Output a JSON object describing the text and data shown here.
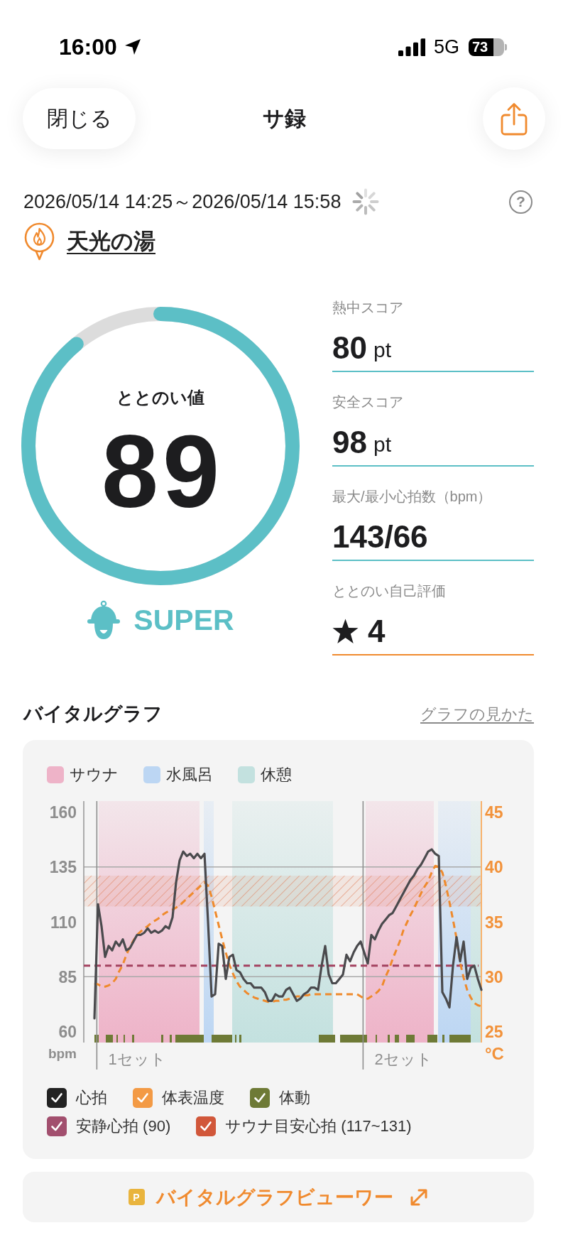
{
  "status_bar": {
    "time": "16:00",
    "network": "5G",
    "battery": "73"
  },
  "nav": {
    "close_button": "閉じる",
    "title": "サ録"
  },
  "session": {
    "period": "2026/05/14 14:25～2026/05/14 15:58",
    "loading": true,
    "help": "?",
    "facility": "天光の湯"
  },
  "gauge": {
    "label": "ととのい値",
    "value": "89",
    "level": 0.89,
    "rank": "SUPER"
  },
  "scores": [
    {
      "kind": "score",
      "label": "熱中スコア",
      "value": "80",
      "unit": "pt"
    },
    {
      "kind": "score",
      "label": "安全スコア",
      "value": "98",
      "unit": "pt"
    },
    {
      "kind": "score",
      "label": "最大/最小心拍数（bpm）",
      "value": "143/66"
    },
    {
      "kind": "rating",
      "label": "ととのい自己評価",
      "value": "4"
    }
  ],
  "vital_graph": {
    "title": "バイタルグラフ",
    "help_link": "グラフの見かた",
    "phase_legend": [
      {
        "label": "サウナ",
        "color": "#eeb3c8"
      },
      {
        "label": "水風呂",
        "color": "#bcd6f3"
      },
      {
        "label": "休憩",
        "color": "#c3e1df"
      }
    ],
    "chart_data": {
      "type": "line",
      "ylabel": "bpm",
      "y2label": "°C",
      "categories": [
        null,
        null,
        null,
        null,
        null,
        null,
        null,
        null,
        null,
        null,
        null,
        null,
        null,
        null,
        null,
        "1セット",
        null,
        null,
        null,
        null,
        null,
        null,
        null,
        null,
        null,
        null,
        null,
        null,
        null,
        null,
        null,
        null,
        null,
        null,
        null,
        null,
        null,
        null,
        null,
        null,
        null,
        null,
        null,
        null,
        null,
        null,
        null,
        null,
        null,
        null,
        null,
        null,
        null,
        null,
        null,
        null,
        null,
        null,
        null,
        null,
        null,
        null,
        null,
        null,
        null,
        null,
        null,
        null,
        null,
        null,
        null,
        null,
        null,
        null,
        null,
        null,
        null,
        null,
        null,
        null,
        null,
        null,
        null,
        null,
        null,
        null,
        null,
        null,
        null,
        null,
        "2セット",
        null,
        null,
        null,
        null,
        null,
        null,
        null,
        null,
        null,
        null,
        null,
        null,
        null,
        null,
        null,
        null,
        null,
        null,
        null,
        null,
        null,
        null
      ],
      "ylim": [
        55,
        165
      ],
      "yticks": [
        60,
        85,
        110,
        135,
        160
      ],
      "y2lim": [
        24,
        46
      ],
      "y2ticks": [
        25,
        30,
        35,
        40,
        45
      ],
      "series": [
        {
          "color": "#4a4a4d",
          "values": [
            null,
            null,
            null,
            66,
            118,
            108,
            94,
            99,
            97,
            101,
            99,
            102,
            97,
            98,
            101,
            104,
            104,
            105,
            107,
            105,
            106,
            105,
            106,
            108,
            107,
            112,
            128,
            138,
            142,
            140,
            141,
            139,
            141,
            139,
            141,
            110,
            76,
            77,
            100,
            99,
            84,
            94,
            95,
            88,
            87,
            84,
            82,
            82,
            80,
            80,
            80,
            78,
            74,
            74,
            77,
            76,
            76,
            79,
            80,
            77,
            74,
            75,
            77,
            78,
            80,
            80,
            79,
            90,
            99,
            86,
            82,
            82,
            84,
            86,
            95,
            92,
            96,
            99,
            101,
            96,
            91,
            104,
            102,
            106,
            109,
            111,
            113,
            114,
            117,
            120,
            123,
            126,
            129,
            131,
            134,
            136,
            139,
            142,
            143,
            141,
            140,
            78,
            75,
            71,
            90,
            103,
            92,
            101,
            84,
            89,
            90,
            84,
            79
          ]
        },
        {
          "color": "#ef8a2c",
          "axis": "y2",
          "line_style": "dashed",
          "values": [
            null,
            null,
            null,
            29.4,
            29.3,
            29.1,
            29.1,
            29.2,
            29.4,
            29.8,
            30.5,
            31.1,
            32.0,
            32.7,
            33.3,
            33.8,
            34.1,
            34.4,
            34.6,
            34.9,
            35.1,
            35.3,
            35.6,
            35.8,
            36.0,
            36.1,
            36.3,
            36.5,
            36.8,
            37.1,
            37.4,
            37.7,
            38.0,
            38.3,
            38.6,
            38.3,
            37.3,
            36.0,
            34.7,
            33.4,
            32.2,
            31.1,
            30.3,
            29.6,
            29.1,
            28.8,
            28.5,
            28.3,
            28.1,
            28.0,
            27.9,
            27.8,
            27.7,
            27.7,
            27.8,
            27.8,
            27.9,
            27.9,
            28.0,
            28.1,
            28.2,
            28.2,
            28.3,
            28.3,
            28.4,
            28.4,
            28.4,
            28.4,
            28.4,
            28.4,
            28.4,
            28.4,
            28.4,
            28.4,
            28.4,
            28.4,
            28.4,
            28.4,
            28.2,
            28.0,
            28.0,
            28.2,
            28.4,
            28.7,
            29.1,
            30.0,
            30.7,
            31.6,
            32.4,
            33.2,
            34.2,
            34.9,
            35.6,
            36.2,
            36.9,
            37.6,
            38.2,
            38.7,
            39.5,
            40.1,
            40.0,
            39.5,
            38.3,
            36.8,
            35.2,
            33.5,
            31.3,
            29.9,
            28.8,
            28.1,
            27.6,
            27.4,
            27.3
          ]
        }
      ],
      "ref_lines": [
        {
          "value": 90,
          "axis": "y",
          "color": "#a3415f"
        }
      ],
      "bands": [
        {
          "from": 117,
          "to": 131,
          "axis": "y",
          "color": "#e07a52"
        }
      ]
    },
    "toggles": [
      {
        "label": "心拍",
        "checked": true,
        "color": "#222222"
      },
      {
        "label": "体表温度",
        "checked": true,
        "color": "#f39a45"
      },
      {
        "label": "体動",
        "checked": true,
        "color": "#6e7a36"
      },
      {
        "label": "安静心拍 (90)",
        "checked": true,
        "color": "#a24f6e"
      },
      {
        "label": "サウナ目安心拍 (117~131)",
        "checked": true,
        "color": "#d1573a"
      }
    ]
  },
  "viewer_button": {
    "badge": "P",
    "label": "バイタルグラフビューワー"
  }
}
